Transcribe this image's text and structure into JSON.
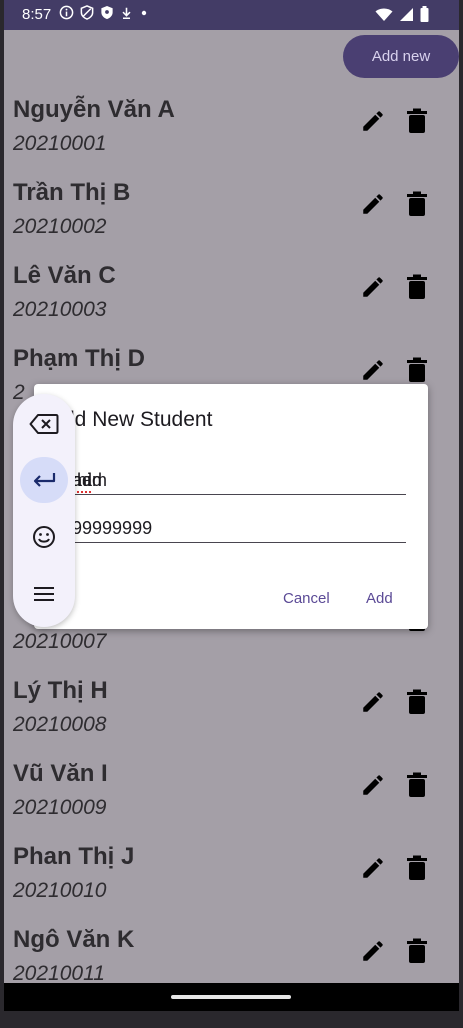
{
  "status_bar": {
    "time": "8:57",
    "left_icons": [
      "info-icon",
      "shield-icon",
      "vpn-icon",
      "download-icon",
      "dot-icon"
    ],
    "right_icons": [
      "wifi-icon",
      "signal-icon",
      "battery-icon"
    ]
  },
  "toolbar": {
    "add_new_label": "Add new"
  },
  "students": [
    {
      "name": "Nguyễn Văn A",
      "id": "20210001"
    },
    {
      "name": "Trần Thị B",
      "id": "20210002"
    },
    {
      "name": "Lê Văn C",
      "id": "20210003"
    },
    {
      "name": "Phạm Thị D",
      "id": "2"
    },
    {
      "name": "",
      "id": "20210007"
    },
    {
      "name": "Lý Thị H",
      "id": "20210008"
    },
    {
      "name": "Vũ Văn I",
      "id": "20210009"
    },
    {
      "name": "Phan Thị J",
      "id": "20210010"
    },
    {
      "name": "Ngô Văn K",
      "id": "20210011"
    }
  ],
  "dialog": {
    "title": "dd New Student",
    "name_value_prefix": "ham ",
    "name_value_misspelled": "thi",
    "name_value_suffix": " add",
    "id_value": "99999999",
    "cancel_label": "Cancel",
    "add_label": "Add"
  },
  "keyboard_panel": {
    "buttons": [
      "backspace-icon",
      "enter-icon",
      "emoji-icon",
      "menu-icon"
    ],
    "active": "enter-icon"
  },
  "colors": {
    "status_bar": "#433c66",
    "scrim_background": "#a49fa7",
    "accent": "#5b4a96",
    "add_new_button": "#4a3f72"
  }
}
